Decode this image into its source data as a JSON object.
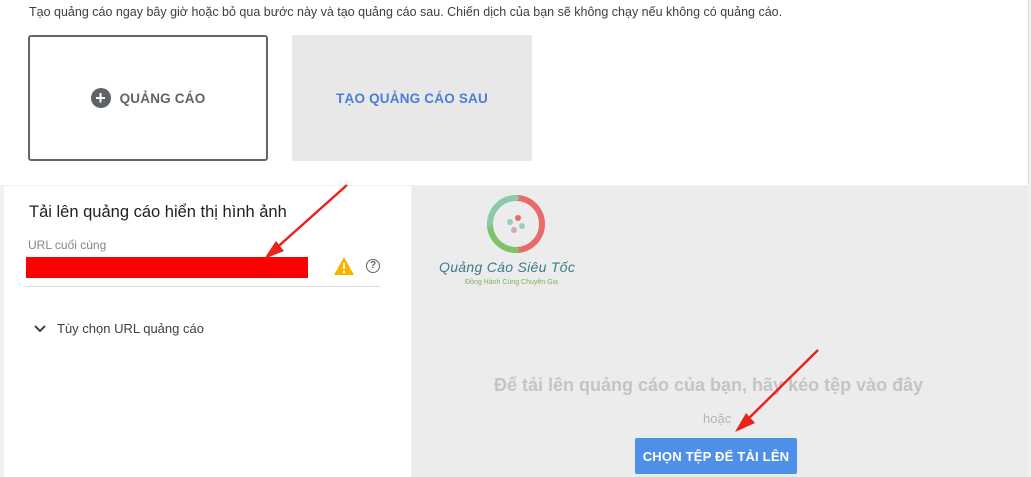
{
  "top": {
    "instruction": "Tạo quảng cáo ngay bây giờ hoặc bỏ qua bước này và tạo quảng cáo sau. Chiến dịch của bạn sẽ không chạy nếu không có quảng cáo.",
    "create_ad_label": "QUẢNG CÁO",
    "create_later_label": "TẠO QUẢNG CÁO SAU"
  },
  "upload_form": {
    "title": "Tải lên quảng cáo hiển thị hình ảnh",
    "final_url_label": "URL cuối cùng",
    "final_url_value": "",
    "url_options_label": "Tùy chọn URL quảng cáo"
  },
  "dropzone": {
    "logo_name": "Quảng Cáo Siêu Tốc",
    "logo_tagline": "Đồng Hành Cùng Chuyên Gia",
    "drop_text": "Để tải lên quảng cáo của bạn, hãy kéo tệp vào đây",
    "or_text": "hoặc",
    "upload_button": "CHỌN TỆP ĐỂ TẢI LÊN"
  },
  "colors": {
    "accent_blue": "#4d8fe9",
    "redaction_red": "#ff0000",
    "warning_yellow": "#f4b400",
    "annotation_arrow": "#e8231e"
  },
  "icons": [
    "plus-circle-icon",
    "warning-icon",
    "help-icon",
    "chevron-down-icon",
    "logo-icon",
    "arrow-annotation"
  ]
}
